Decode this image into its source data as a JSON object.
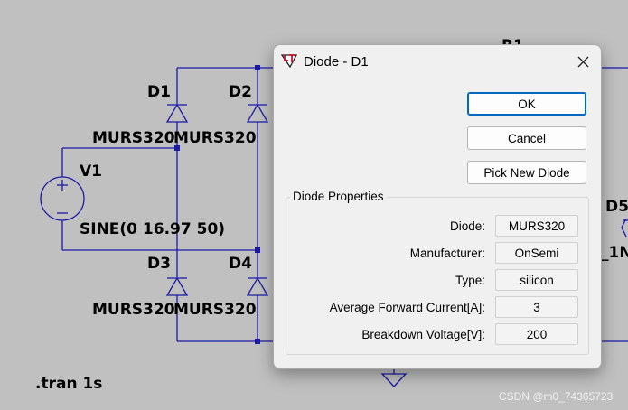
{
  "schematic": {
    "labels": {
      "d1": "D1",
      "d2": "D2",
      "d3": "D3",
      "d4": "D4",
      "d1_model": "MURS320",
      "d2_model": "MURS320",
      "d3_model": "MURS320",
      "d4_model": "MURS320",
      "v1": "V1",
      "v1_value": "SINE(0 16.97 50)",
      "r1_partial": "R1",
      "d5_partial": "D5",
      "d5_model_partial": "_1N",
      "directive": ".tran 1s"
    },
    "wire_color": "#1a1aa6",
    "background_color": "#c0c0c0"
  },
  "dialog": {
    "title": "Diode - D1",
    "app_icon": "ltspice-icon",
    "close_icon": "close-icon",
    "buttons": {
      "ok": "OK",
      "cancel": "Cancel",
      "pick_new": "Pick New Diode"
    },
    "properties": {
      "group_label": "Diode Properties",
      "rows": [
        {
          "label": "Diode:",
          "value": "MURS320"
        },
        {
          "label": "Manufacturer:",
          "value": "OnSemi"
        },
        {
          "label": "Type:",
          "value": "silicon"
        },
        {
          "label": "Average Forward Current[A]:",
          "value": "3"
        },
        {
          "label": "Breakdown Voltage[V]:",
          "value": "200"
        }
      ]
    },
    "accent_color": "#0067c0"
  },
  "watermark": "CSDN @m0_74365723"
}
